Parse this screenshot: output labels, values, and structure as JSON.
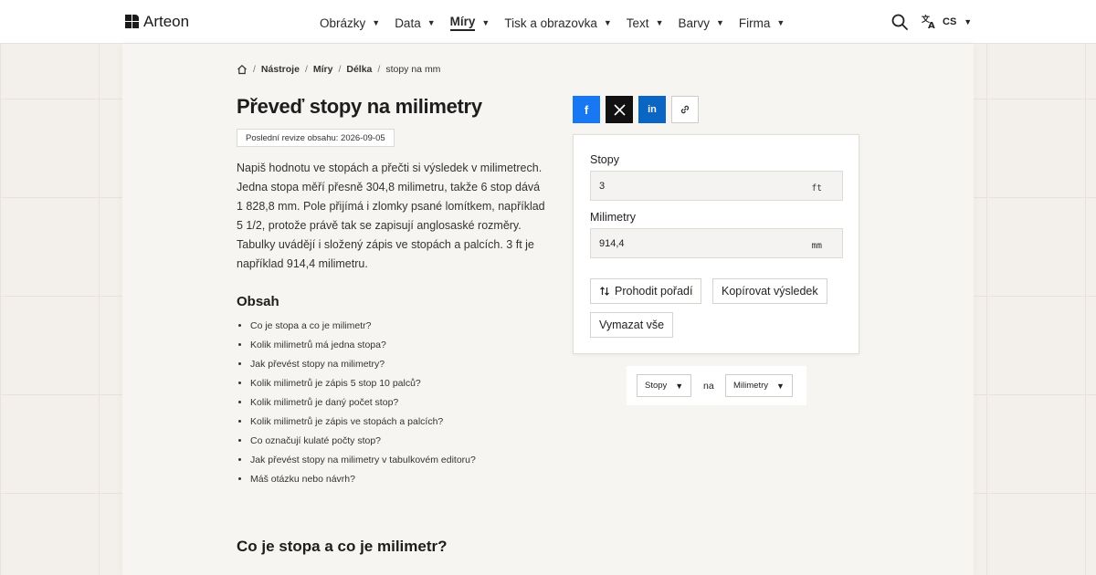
{
  "header": {
    "logo_text": "Arteon",
    "nav": [
      {
        "label": "Obrázky",
        "active": false
      },
      {
        "label": "Data",
        "active": false
      },
      {
        "label": "Míry",
        "active": true
      },
      {
        "label": "Tisk a obrazovka",
        "active": false
      },
      {
        "label": "Text",
        "active": false
      },
      {
        "label": "Barvy",
        "active": false
      },
      {
        "label": "Firma",
        "active": false
      }
    ],
    "lang_label": "CS",
    "icons": [
      "search-icon",
      "translate-icon"
    ]
  },
  "breadcrumb": {
    "home_icon": "home-icon",
    "items": [
      "Nástroje",
      "Míry",
      "Délka"
    ],
    "current": "stopy na mm"
  },
  "page": {
    "title": "Převeď stopy na milimetry",
    "revision": "Poslední revize obsahu: 2026-09-05",
    "intro": "Napiš hodnotu ve stopách a přečti si výsledek v milimetrech. Jedna stopa měří přesně 304,8 milimetru, takže 6 stop dává 1 828,8 mm. Pole přijímá i zlomky psané lomítkem, například 5 1/2, protože právě tak se zapisují anglosaské rozměry. Tabulky uvádějí i složený zápis ve stopách a palcích. 3 ft je například 914,4 milimetru.",
    "toc_title": "Obsah",
    "toc": [
      "Co je stopa a co je milimetr?",
      "Kolik milimetrů má jedna stopa?",
      "Jak převést stopy na milimetry?",
      "Kolik milimetrů je zápis 5 stop 10 palců?",
      "Kolik milimetrů je daný počet stop?",
      "Kolik milimetrů je zápis ve stopách a palcích?",
      "Co označují kulaté počty stop?",
      "Jak převést stopy na milimetry v tabulkovém editoru?",
      "Máš otázku nebo návrh?"
    ],
    "section_title": "Co je stopa a co je milimetr?"
  },
  "share": {
    "facebook": "f",
    "x": "X",
    "linkedin": "in",
    "link_icon": "link-icon",
    "colors": {
      "facebook": "#1877f2",
      "x": "#111111",
      "linkedin": "#0a66c2"
    }
  },
  "converter": {
    "from_label": "Stopy",
    "from_value": "3",
    "from_unit": "ft",
    "to_label": "Milimetry",
    "to_value": "914,4",
    "to_unit": "mm",
    "swap_label": "Prohodit pořadí",
    "copy_label": "Kopírovat výsledek",
    "clear_label": "Vymazat vše"
  },
  "unit_selector": {
    "from": "Stopy",
    "connector": "na",
    "to": "Milimetry"
  }
}
